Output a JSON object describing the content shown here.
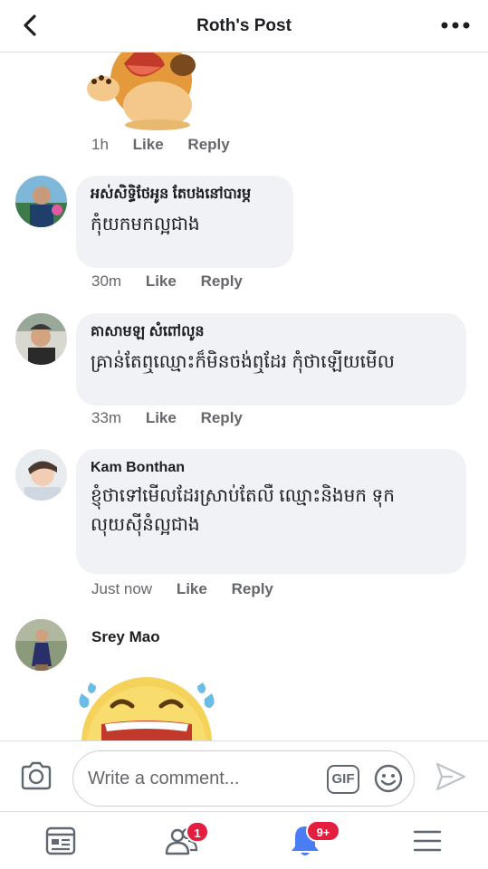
{
  "header": {
    "title": "Roth's Post",
    "back_icon": "chevron-left-icon",
    "more_icon": "more-dots-icon"
  },
  "stickers": {
    "first": "dog-sticker",
    "last": "laughing-emoji-sticker"
  },
  "comments": [
    {
      "author": "",
      "text": "",
      "time": "1h",
      "like": "Like",
      "reply": "Reply"
    },
    {
      "author": "អស់សិទ្ធិថែអូន តែបងនៅបារម្ភ",
      "text": "កុំយកមកល្អជាង",
      "time": "30m",
      "like": "Like",
      "reply": "Reply"
    },
    {
      "author": "គាសាមឡ សំពៅលូន",
      "text": "គ្រាន់តែឮឈ្មោះក៏មិនចង់ឮដែរ កុំថាឡើយមើល",
      "time": "33m",
      "like": "Like",
      "reply": "Reply"
    },
    {
      "author": "Kam Bonthan",
      "text_line1": "ខ្ញុំថាទៅមើលដែរស្រាប់តែលឺ ឈ្មោះនិងមក ទុក",
      "text_line2": "លុយស៊ីនំល្អជាង",
      "time": "Just now",
      "like": "Like",
      "reply": "Reply"
    },
    {
      "author": "Srey Mao"
    }
  ],
  "composer": {
    "placeholder": "Write a comment...",
    "gif_label": "GIF",
    "camera_icon": "camera-icon",
    "emoji_icon": "smiley-icon",
    "send_icon": "send-icon"
  },
  "nav": {
    "friends_badge": "1",
    "notifications_badge": "9+"
  },
  "colors": {
    "badge": "#e41e3f",
    "bubble": "#f0f2f5",
    "meta": "#65676b"
  }
}
